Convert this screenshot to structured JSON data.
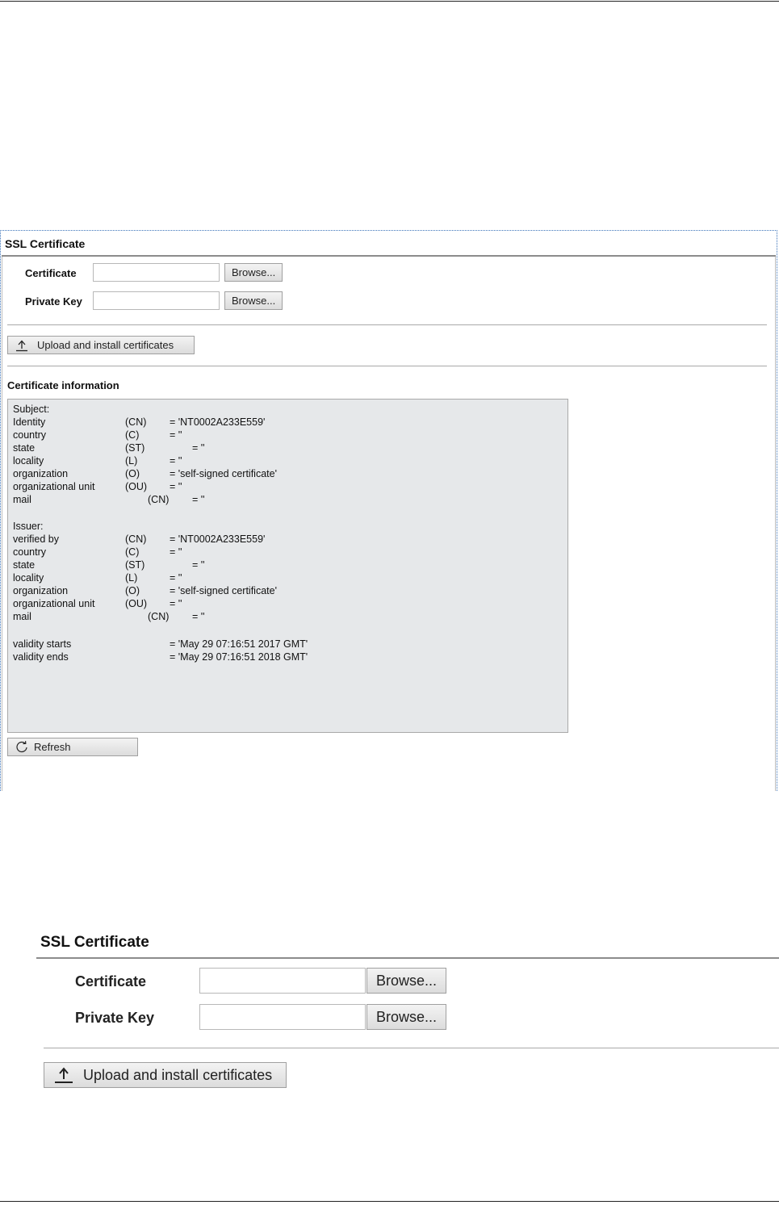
{
  "panel_small": {
    "title": "SSL Certificate",
    "certificate_label": "Certificate",
    "private_key_label": "Private Key",
    "browse_label": "Browse...",
    "upload_label": "Upload and install certificates",
    "info_title": "Certificate information",
    "refresh_label": "Refresh",
    "subject_heading": "Subject:",
    "subject_rows": [
      {
        "label": "Identity",
        "code": "(CN)",
        "value": "= 'NT0002A233E559'"
      },
      {
        "label": "country",
        "code": "(C)",
        "value": "= ''"
      },
      {
        "label": "state",
        "code": "(ST)",
        "value": "= ''"
      },
      {
        "label": "locality",
        "code": "(L)",
        "value": "= ''"
      },
      {
        "label": "organization",
        "code": "(O)",
        "value": "= 'self-signed certificate'"
      },
      {
        "label": "organizational unit",
        "code": "(OU)",
        "value": "= ''"
      },
      {
        "label": "mail",
        "code": "(CN)",
        "value": "= ''"
      }
    ],
    "issuer_heading": "Issuer:",
    "issuer_rows": [
      {
        "label": "verified by",
        "code": "(CN)",
        "value": "= 'NT0002A233E559'"
      },
      {
        "label": "country",
        "code": "(C)",
        "value": "= ''"
      },
      {
        "label": "state",
        "code": "(ST)",
        "value": "= ''"
      },
      {
        "label": "locality",
        "code": "(L)",
        "value": "= ''"
      },
      {
        "label": "organization",
        "code": "(O)",
        "value": "= 'self-signed certificate'"
      },
      {
        "label": "organizational unit",
        "code": "(OU)",
        "value": "= ''"
      },
      {
        "label": "mail",
        "code": "(CN)",
        "value": "= ''"
      }
    ],
    "validity_rows": [
      {
        "label": "validity starts",
        "value": "= 'May 29 07:16:51 2017 GMT'"
      },
      {
        "label": "validity ends",
        "value": "= 'May 29 07:16:51 2018 GMT'"
      }
    ]
  },
  "panel_large": {
    "title": "SSL Certificate",
    "certificate_label": "Certificate",
    "private_key_label": "Private Key",
    "browse_label": "Browse...",
    "upload_label": "Upload and install certificates"
  },
  "icons": {
    "upload": "upload-arrow-icon",
    "refresh": "refresh-arrow-icon"
  }
}
